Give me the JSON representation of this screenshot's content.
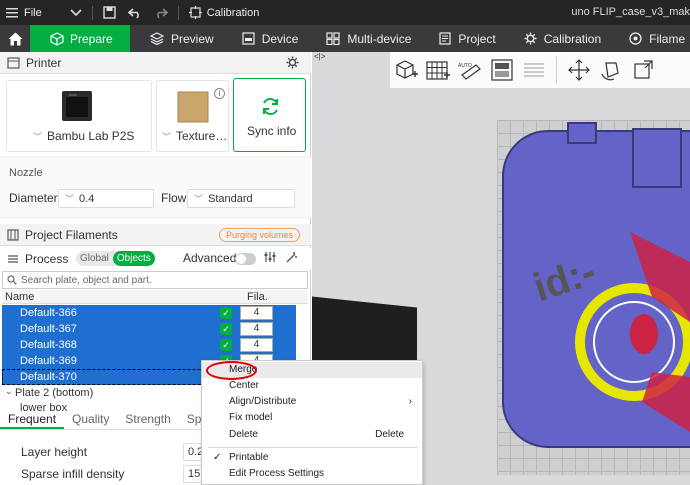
{
  "titlebar": {
    "file_menu": "File",
    "calibration": "Calibration",
    "window_title": "uno FLIP_case_v3_mak"
  },
  "tabs": [
    {
      "label": "Prepare",
      "active": true
    },
    {
      "label": "Preview"
    },
    {
      "label": "Device"
    },
    {
      "label": "Multi-device"
    },
    {
      "label": "Project"
    },
    {
      "label": "Calibration"
    },
    {
      "label": "Filame"
    }
  ],
  "printer": {
    "section_title": "Printer",
    "printer_name": "Bambu Lab P2S",
    "plate_name": "Texture…",
    "sync_label": "Sync info",
    "nozzle_label": "Nozzle",
    "diameter_label": "Diameter",
    "diameter_value": "0.4",
    "flow_label": "Flow",
    "flow_value": "Standard"
  },
  "filaments": {
    "section_title": "Project Filaments",
    "purge_button": "Purging volumes"
  },
  "process": {
    "section_title": "Process",
    "global_label": "Global",
    "objects_label": "Objects",
    "objects_selected": true,
    "advanced_label": "Advanced"
  },
  "objects_list": {
    "search_placeholder": "Search plate, object and part.",
    "col_name": "Name",
    "col_fila": "Fila.",
    "rows": [
      {
        "name": "Default-366",
        "fila": "4"
      },
      {
        "name": "Default-367",
        "fila": "4"
      },
      {
        "name": "Default-368",
        "fila": "4"
      },
      {
        "name": "Default-369",
        "fila": "4"
      },
      {
        "name": "Default-370",
        "fila": "4"
      }
    ],
    "plate_label": "Plate 2 (bottom)",
    "lower_box": "lower box"
  },
  "settings_tabs": [
    "Frequent",
    "Quality",
    "Strength",
    "Speed"
  ],
  "params": [
    {
      "label": "Layer height",
      "value": "0.2"
    },
    {
      "label": "Sparse infill density",
      "value": "15"
    }
  ],
  "context_menu": {
    "items": [
      {
        "label": "Merge",
        "highlight": true
      },
      {
        "label": "Center"
      },
      {
        "label": "Align/Distribute",
        "submenu": true
      },
      {
        "label": "Fix model"
      },
      {
        "label": "Delete",
        "shortcut": "Delete"
      },
      {
        "label": "Printable",
        "checked": true
      },
      {
        "label": "Edit Process Settings"
      }
    ]
  },
  "colors": {
    "accent": "#00ae42",
    "selection": "#1f6fd1",
    "model": "#6464c8",
    "annotation": "#e00000"
  }
}
